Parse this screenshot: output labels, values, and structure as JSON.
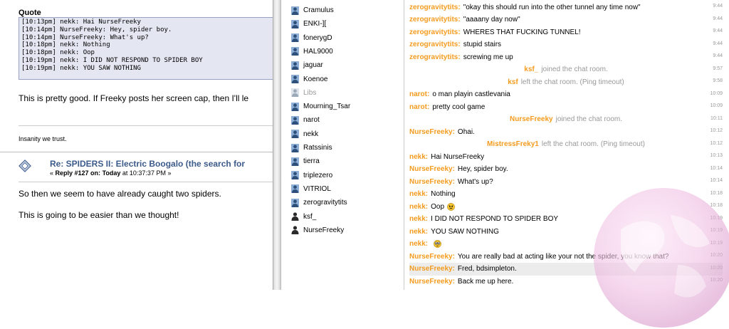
{
  "forum": {
    "quote_label": "Quote",
    "quote_lines": [
      "[10:13pm] nekk: Hai NurseFreeky",
      "[10:14pm] NurseFreeky: Hey, spider boy.",
      "[10:14pm] NurseFreeky: What's up?",
      "[10:18pm] nekk: Nothing",
      "[10:18pm] nekk: Oop",
      "[10:19pm] nekk: I DID NOT RESPOND TO SPIDER BOY",
      "[10:19pm] nekk: YOU SAW NOTHING"
    ],
    "post_text": "This is pretty good. If Freeky posts her screen cap, then I'll le",
    "signature": "Insanity we trust.",
    "post2": {
      "title": "Re: SPIDERS II: Electric Boogalo (the search for",
      "meta_prefix": "« ",
      "meta_reply": "Reply #127 on:",
      "meta_today": "Today",
      "meta_time": " at 10:37:37 PM »",
      "body1": "So then we seem to have already caught two spiders.",
      "body2": "This is going to be easier than we thought!"
    }
  },
  "users": [
    {
      "name": "Cramulus",
      "status": "active"
    },
    {
      "name": "ENKI-][",
      "status": "active"
    },
    {
      "name": "fonerygD",
      "status": "active"
    },
    {
      "name": "HAL9000",
      "status": "active"
    },
    {
      "name": "jaguar",
      "status": "active"
    },
    {
      "name": "Koenoe",
      "status": "active"
    },
    {
      "name": "Libs",
      "status": "away"
    },
    {
      "name": "Mourning_Tsar",
      "status": "active"
    },
    {
      "name": "narot",
      "status": "active"
    },
    {
      "name": "nekk",
      "status": "active"
    },
    {
      "name": "Ratssinis",
      "status": "active"
    },
    {
      "name": "tierra",
      "status": "active"
    },
    {
      "name": "triplezero",
      "status": "active"
    },
    {
      "name": "VITRIOL",
      "status": "active"
    },
    {
      "name": "zerogravitytits",
      "status": "active"
    },
    {
      "name": "ksf_",
      "status": "plain"
    },
    {
      "name": "NurseFreeky",
      "status": "plain"
    }
  ],
  "chat": [
    {
      "type": "msg",
      "nick": "zerogravitytits:",
      "text": "\"okay this should run into the other tunnel any time now\"",
      "time": "9:44"
    },
    {
      "type": "msg",
      "nick": "zerogravitytits:",
      "text": "\"aaaany day now\"",
      "time": "9:44"
    },
    {
      "type": "msg",
      "nick": "zerogravitytits:",
      "text": "WHERES THAT FUCKING TUNNEL!",
      "time": "9:44"
    },
    {
      "type": "msg",
      "nick": "zerogravitytits:",
      "text": "stupid stairs",
      "time": "9:44"
    },
    {
      "type": "msg",
      "nick": "zerogravitytits:",
      "text": "screwing me up",
      "time": "9:44"
    },
    {
      "type": "sys",
      "nick": "ksf_",
      "text": "joined the chat room.",
      "time": "9:57"
    },
    {
      "type": "sys",
      "nick": "ksf",
      "text": "left the chat room. (Ping timeout)",
      "time": "9:58"
    },
    {
      "type": "msg",
      "nick": "narot:",
      "text": "o man playin castlevania",
      "time": "10:09"
    },
    {
      "type": "msg",
      "nick": "narot:",
      "text": "pretty cool game",
      "time": "10:09"
    },
    {
      "type": "sys",
      "nick": "NurseFreeky",
      "text": "joined the chat room.",
      "time": "10:11"
    },
    {
      "type": "msg",
      "nick": "NurseFreeky:",
      "text": "Ohai.",
      "time": "10:12"
    },
    {
      "type": "sys",
      "nick": "MistressFreky1",
      "text": "left the chat room. (Ping timeout)",
      "time": "10:12"
    },
    {
      "type": "msg",
      "nick": "nekk:",
      "text": "Hai NurseFreeky",
      "time": "10:13"
    },
    {
      "type": "msg",
      "nick": "NurseFreeky:",
      "text": "Hey, spider boy.",
      "time": "10:14"
    },
    {
      "type": "msg",
      "nick": "NurseFreeky:",
      "text": "What's up?",
      "time": "10:14"
    },
    {
      "type": "msg",
      "nick": "nekk:",
      "text": "Nothing",
      "time": "10:18"
    },
    {
      "type": "msg",
      "nick": "nekk:",
      "text": "Oop",
      "time": "10:18",
      "emoji": "angry-face"
    },
    {
      "type": "msg",
      "nick": "nekk:",
      "text": "I DID NOT RESPOND TO SPIDER BOY",
      "time": "10:19"
    },
    {
      "type": "msg",
      "nick": "nekk:",
      "text": "YOU SAW NOTHING",
      "time": "10:19"
    },
    {
      "type": "msg",
      "nick": "nekk:",
      "text": "",
      "time": "10:19",
      "emoji": "eyes-face"
    },
    {
      "type": "msg",
      "nick": "NurseFreeky:",
      "text": "You are really bad at acting like your not the spider, you know that?",
      "time": "10:20"
    },
    {
      "type": "msg",
      "nick": "NurseFreeky:",
      "text": "Fred, bdsimpleton.",
      "time": "10:20",
      "highlight": true
    },
    {
      "type": "msg",
      "nick": "NurseFreeky:",
      "text": "Back me up here.",
      "time": "10:20"
    }
  ],
  "colors": {
    "nick": "#f49b1d",
    "link": "#3c5a8a",
    "quote_bg": "#e4e6f1"
  }
}
